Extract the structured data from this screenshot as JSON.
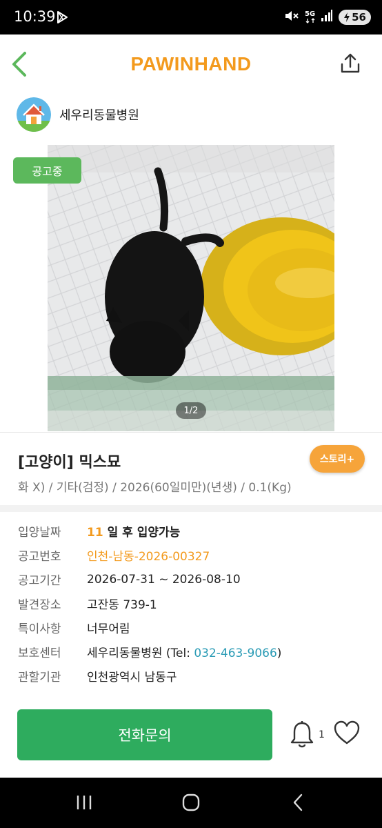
{
  "status_bar": {
    "time": "10:39",
    "network": "5G",
    "battery": "56",
    "icons": [
      "play-store-icon",
      "mute-icon",
      "5g-icon",
      "signal-icon",
      "battery-icon"
    ]
  },
  "header": {
    "brand": "PAWINHAND",
    "brand_color": "#f39a1d",
    "icons": [
      "back-icon",
      "share-icon"
    ]
  },
  "shelter": {
    "name": "세우리동물병원",
    "icon": "shelter-house-icon"
  },
  "photo": {
    "status_chip": "공고중",
    "page_indicator": "1/2"
  },
  "animal": {
    "title": "[고양이] 믹스묘",
    "subtitle": "화 X) / 기타(검정) / 2026(60일미만)(년생) / 0.1(Kg)",
    "story_button": "스토리+"
  },
  "info": {
    "adopt_date": {
      "label": "입양날짜",
      "days": "11",
      "text": "일 후 입양가능"
    },
    "notice_no": {
      "label": "공고번호",
      "value": "인천-남동-2026-00327"
    },
    "period": {
      "label": "공고기간",
      "value": "2026-07-31 ~ 2026-08-10"
    },
    "found_place": {
      "label": "발견장소",
      "value": "고잔동 739-1"
    },
    "special": {
      "label": "특이사항",
      "value": "너무어림"
    },
    "center": {
      "label": "보호센터",
      "value": "세우리동물병원",
      "tel_prefix": "(Tel: ",
      "tel": "032-463-9066",
      "tel_suffix": ")"
    },
    "agency": {
      "label": "관할기관",
      "value": "인천광역시 남동구"
    }
  },
  "actions": {
    "call_button": "전화문의",
    "bell_count": "1",
    "accent_green": "#2eac5e"
  },
  "nav": {
    "icons": [
      "recent-apps-icon",
      "home-icon",
      "back-nav-icon"
    ]
  }
}
